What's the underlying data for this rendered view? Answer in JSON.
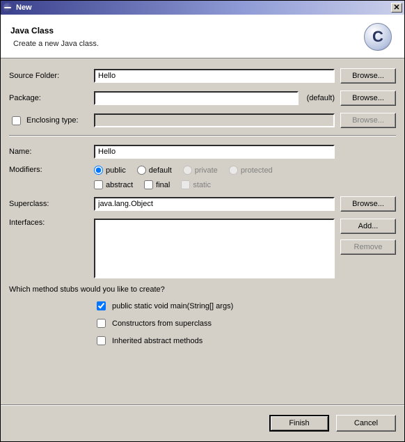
{
  "window": {
    "title": "New"
  },
  "header": {
    "title": "Java Class",
    "subtitle": "Create a new Java class."
  },
  "labels": {
    "sourceFolder": "Source Folder:",
    "package": "Package:",
    "enclosingType": "Enclosing type:",
    "name": "Name:",
    "modifiers": "Modifiers:",
    "superclass": "Superclass:",
    "interfaces": "Interfaces:",
    "stubsQuestion": "Which method stubs would you like to create?"
  },
  "fields": {
    "sourceFolder": "Hello",
    "package": "",
    "packageSuffix": "(default)",
    "enclosingType": "",
    "name": "Hello",
    "superclass": "java.lang.Object"
  },
  "modifiers": {
    "visibility": {
      "public": "public",
      "default": "default",
      "private": "private",
      "protected": "protected",
      "selected": "public"
    },
    "flags": {
      "abstract": "abstract",
      "final": "final",
      "static": "static"
    }
  },
  "stubs": {
    "main": "public static void main(String[] args)",
    "constructors": "Constructors from superclass",
    "inherited": "Inherited abstract methods",
    "checked": [
      "main"
    ]
  },
  "buttons": {
    "browse": "Browse...",
    "add": "Add...",
    "remove": "Remove",
    "finish": "Finish",
    "cancel": "Cancel"
  }
}
